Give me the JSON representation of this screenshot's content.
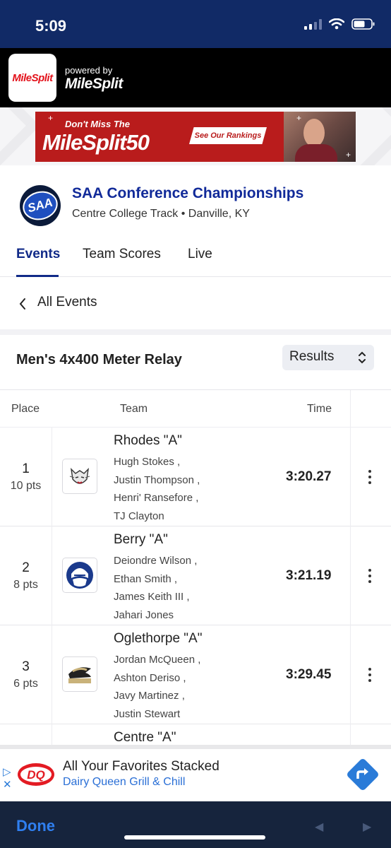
{
  "status_bar": {
    "time": "5:09"
  },
  "app_header": {
    "logo_text": "MileSplit",
    "powered_by": "powered by",
    "brand": "MileSplit"
  },
  "banner": {
    "top_text": "Don't Miss The",
    "main_text": "MileSplit50",
    "button_text": "See Our Rankings"
  },
  "meet": {
    "logo_text": "SAA",
    "title": "SAA Conference Championships",
    "subtitle": "Centre College Track • Danville, KY",
    "tabs": [
      "Events",
      "Team Scores",
      "Live"
    ],
    "active_tab": "Events"
  },
  "back": {
    "label": "All Events"
  },
  "event": {
    "title": "Men's 4x400 Meter Relay",
    "view_select": "Results"
  },
  "table": {
    "headers": {
      "place": "Place",
      "team": "Team",
      "time": "Time"
    },
    "rows": [
      {
        "place": "1",
        "points": "10 pts",
        "team": "Rhodes \"A\"",
        "athletes": [
          "Hugh Stokes ,",
          "Justin Thompson ,",
          "Henri' Ransefore ,",
          "TJ Clayton"
        ],
        "time": "3:20.27",
        "logo": "lynx-icon"
      },
      {
        "place": "2",
        "points": "8 pts",
        "team": "Berry \"A\"",
        "athletes": [
          "Deiondre Wilson ,",
          "Ethan Smith ,",
          "James Keith III ,",
          "Jahari Jones"
        ],
        "time": "3:21.19",
        "logo": "viking-icon"
      },
      {
        "place": "3",
        "points": "6 pts",
        "team": "Oglethorpe \"A\"",
        "athletes": [
          "Jordan McQueen ,",
          "Ashton Deriso ,",
          "Javy Martinez ,",
          "Justin Stewart"
        ],
        "time": "3:29.45",
        "logo": "petrel-icon"
      },
      {
        "place": "",
        "points": "",
        "team": "Centre \"A\"",
        "athletes": [],
        "time": "",
        "logo": ""
      }
    ]
  },
  "ad": {
    "logo": "DQ",
    "title": "All Your Favorites Stacked",
    "subtitle": "Dairy Queen Grill & Chill"
  },
  "toolbar": {
    "done_label": "Done"
  },
  "colors": {
    "brand_navy": "#112a88",
    "status_bar": "#112a66",
    "accent_blue": "#2f7ff0",
    "banner_red": "#b91c1c"
  }
}
